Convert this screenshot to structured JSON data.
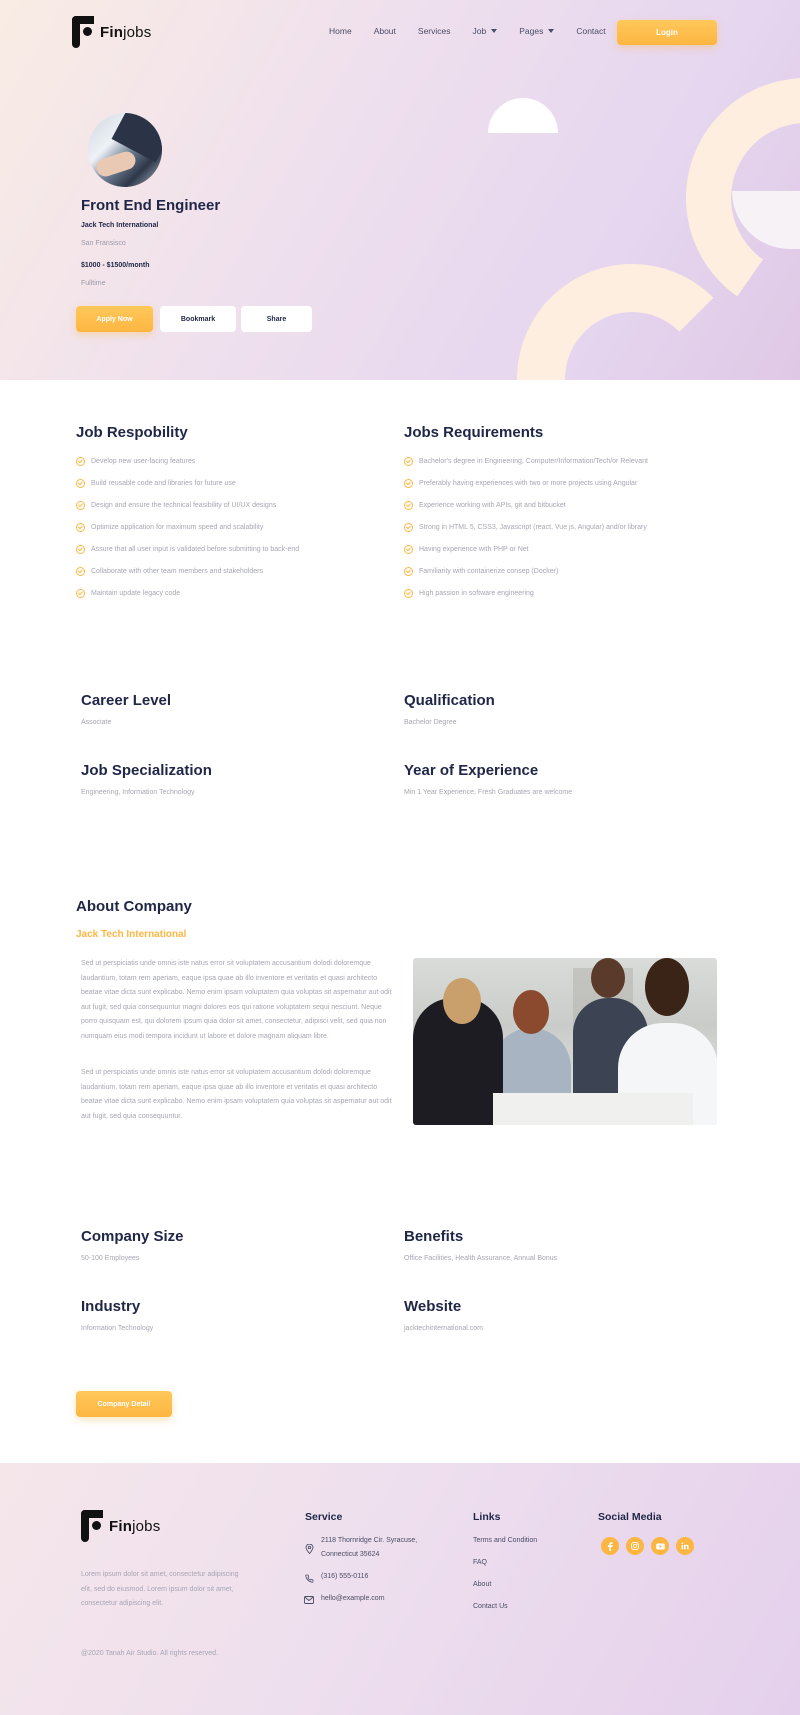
{
  "brand": {
    "name_bold": "Fin",
    "name_light": "jobs"
  },
  "nav": {
    "items": [
      {
        "label": "Home"
      },
      {
        "label": "About"
      },
      {
        "label": "Services"
      },
      {
        "label": "Job"
      },
      {
        "label": "Pages"
      },
      {
        "label": "Contact"
      }
    ],
    "login_label": "Login"
  },
  "job": {
    "title": "Front End Engineer",
    "company": "Jack Tech International",
    "location": "San Fransisco",
    "salary": "$1000 - $1500/month",
    "type": "Fulltime",
    "apply_label": "Apply Now",
    "bookmark_label": "Bookmark",
    "share_label": "Share"
  },
  "responsibility": {
    "heading": "Job Respobility",
    "items": [
      "Develop new user-facing features",
      "Build reusable code and libraries for future use",
      "Design and ensure the technical feasibility of UI/UX designs",
      "Optimize application for maximum speed and scalability",
      "Assure that all user input is validated before submitting to back-end",
      "Collaborate with other team members and stakeholders",
      "Maintain update legacy code"
    ]
  },
  "requirements": {
    "heading": "Jobs Requirements",
    "items": [
      "Bachelor's degree in Engineering, Computer/Information/Tech/or Relevant",
      "Preferably having experiences with two or more projects using Angular",
      "Experience working with APIs, git and bitbucket",
      "Strong in HTML 5, CSS3, Javascript (react, Vue js, Angular) and/or library",
      "Having experience with PHP or Net",
      "Familiarity with containerize consep (Docker)",
      "High passion in software engineering"
    ]
  },
  "job_info": {
    "career_level": {
      "label": "Career Level",
      "value": "Associate"
    },
    "qualification": {
      "label": "Qualification",
      "value": "Bachelor Degree"
    },
    "specialization": {
      "label": "Job Specialization",
      "value": "Engineering, Information Technology"
    },
    "experience": {
      "label": "Year of Experience",
      "value": "Min 1 Year Experience, Fresh Graduates are welcome"
    }
  },
  "about": {
    "heading": "About Company",
    "company": "Jack Tech International",
    "paragraph1": "Sed ut perspiciatis unde omnis iste natus error sit voluptatem accusantium dolodi doloremque laudantium, totam rem aperiam, eaque ipsa quae ab illo inventore et veritatis et quasi architecto beatae vitae dicta sunt explicabo. Nemo enim ipsam voluptatem quia voluptas sit aspernatur aut odit aut fugit, sed quia consequuntur magni dolores eos qui ratione voluptatem sequi nesciunt. Neque porro quisquam est, qui dolorem ipsum quia dolor sit amet, consectetur, adipisci velit, sed quia non numquam eius modi tempora incidunt ut labore et dolore magnam aliquam libre.",
    "paragraph2": "Sed ut perspiciatis unde omnis iste natus error sit voluptatem accusantium dolodi doloremque laudantium, totam rem aperiam, eaque ipsa quae ab illo inventore et veritatis et quasi architecto beatae vitae dicta sunt explicabo. Nemo enim ipsam voluptatem quia voluptas sit aspernatur aut odit aut fugit, sed quia consequuntur."
  },
  "company_info": {
    "size": {
      "label": "Company Size",
      "value": "50-100 Employees"
    },
    "benefits": {
      "label": "Benefits",
      "value": "Office Facilities, Health Assurance, Annual Bonus"
    },
    "industry": {
      "label": "Industry",
      "value": "Information Technology"
    },
    "website": {
      "label": "Website",
      "value": "jacktechinternational.com"
    },
    "detail_label": "Company Detail"
  },
  "footer": {
    "description": "Lorem ipsum dolor sit amet, consectetur adipiscing elit, sed do eiusmod. Lorem ipsum dolor sit amet, consectetur adipiscing elit.",
    "copyright": "@2020 Tanah Air Studio. All rights reserved.",
    "service": {
      "heading": "Service",
      "address_line1": "2118 Thornridge Cir. Syracuse,",
      "address_line2": "Connecticut 35624",
      "phone": "(316) 555-0116",
      "email": "hello@example.com"
    },
    "links": {
      "heading": "Links",
      "items": [
        "Terms and Condition",
        "FAQ",
        "About",
        "Contact Us"
      ]
    },
    "social": {
      "heading": "Social Media",
      "icons": [
        "facebook-icon",
        "instagram-icon",
        "youtube-icon",
        "linkedin-icon"
      ]
    }
  },
  "colors": {
    "accent": "#fdb642",
    "heading": "#1f2647",
    "muted": "#a6a6b4"
  }
}
